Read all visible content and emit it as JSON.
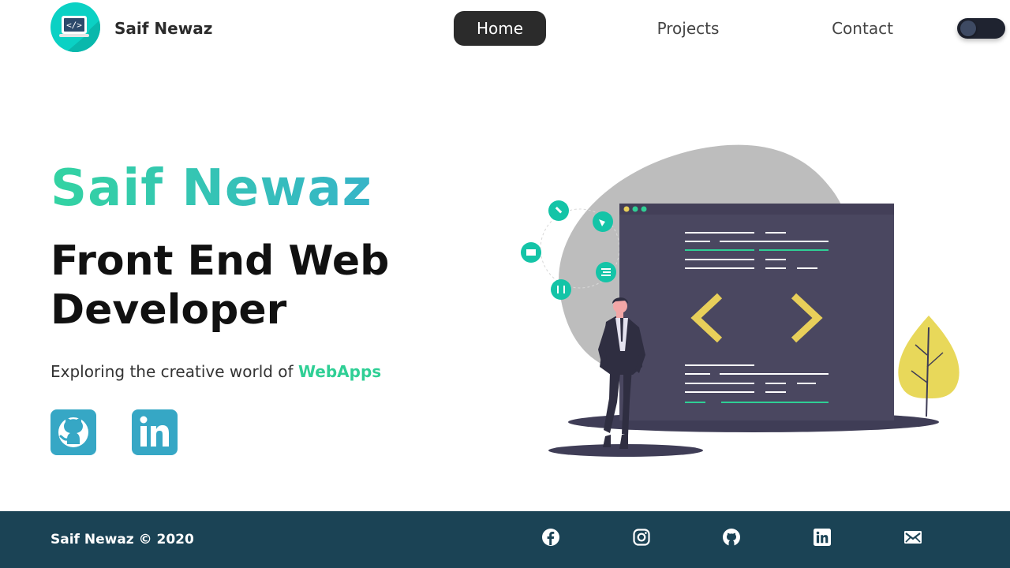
{
  "nav": {
    "brand": "Saif Newaz",
    "logo_icon": "code-monitor-icon",
    "links": [
      "Home",
      "Projects",
      "Contact"
    ],
    "active": "Home",
    "theme_toggle": "dark-mode-toggle"
  },
  "hero": {
    "name": "Saif Newaz",
    "title": "Front End Web Developer",
    "tagline_prefix": "Exploring the creative world of ",
    "tagline_highlight": "WebApps",
    "social": [
      "github-icon",
      "linkedin-icon"
    ]
  },
  "footer": {
    "copyright": "Saif Newaz © 2020",
    "icons": [
      "facebook-icon",
      "instagram-icon",
      "github-icon",
      "linkedin-icon",
      "mail-icon"
    ]
  },
  "colors": {
    "accent_green": "#2fcf95",
    "accent_teal": "#36a7c5",
    "logo_bg": "#0bd1c4",
    "nav_active_bg": "#2b2b2b",
    "footer_bg": "#1b4355",
    "code_window": "#4a4760",
    "code_accent_yellow": "#e8cf5a"
  }
}
